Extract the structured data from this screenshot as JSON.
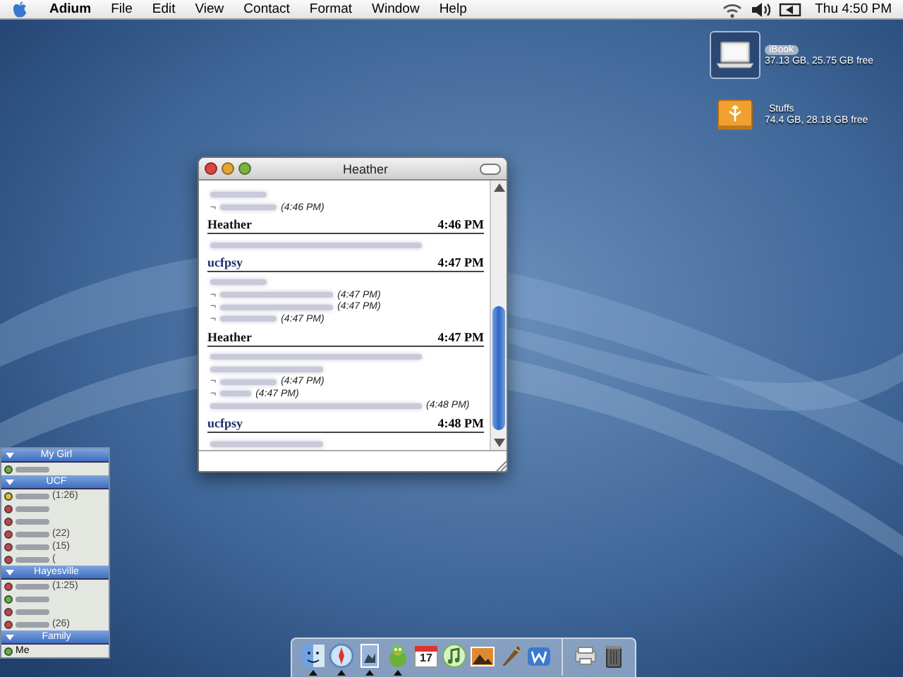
{
  "menubar": {
    "app": "Adium",
    "menus": [
      "File",
      "Edit",
      "View",
      "Contact",
      "Format",
      "Window",
      "Help"
    ],
    "clock": "Thu 4:50 PM"
  },
  "desktop_icons": [
    {
      "kind": "laptop",
      "label": "iBook",
      "detail": "37.13 GB, 25.75 GB free",
      "selected": true
    },
    {
      "kind": "drive",
      "label": "Stuffs",
      "detail": "74.4 GB, 28.18 GB free",
      "selected": false
    }
  ],
  "chat_window": {
    "title": "Heather",
    "messages": [
      {
        "lines": [
          {
            "kind": "short"
          },
          {
            "marker": "¬",
            "kind": "short",
            "time": "(4:46 PM)"
          }
        ]
      },
      {
        "sender": "Heather",
        "kind": "remote",
        "time": "4:46 PM",
        "lines": [
          {
            "kind": "long"
          }
        ]
      },
      {
        "sender": "ucfpsy",
        "kind": "local",
        "time": "4:47 PM",
        "lines": [
          {
            "kind": "short"
          },
          {
            "marker": "¬",
            "kind": "medium",
            "time": "(4:47 PM)"
          },
          {
            "marker": "¬",
            "kind": "medium",
            "time": "(4:47 PM)"
          },
          {
            "marker": "¬",
            "kind": "short",
            "time": "(4:47 PM)"
          }
        ]
      },
      {
        "sender": "Heather",
        "kind": "remote",
        "time": "4:47 PM",
        "lines": [
          {
            "kind": "long"
          },
          {
            "kind": "medium"
          },
          {
            "marker": "¬",
            "kind": "short",
            "time": "(4:47 PM)"
          },
          {
            "marker": "¬",
            "kind": "tiny",
            "time": "(4:47 PM)"
          },
          {
            "kind": "long",
            "time": "(4:48 PM)"
          }
        ]
      },
      {
        "sender": "ucfpsy",
        "kind": "local",
        "time": "4:48 PM",
        "lines": [
          {
            "kind": "medium"
          }
        ]
      }
    ]
  },
  "buddy_list": [
    {
      "name": "My Girl",
      "expanded": true,
      "buddies": [
        {
          "color": "#5fb83a"
        }
      ]
    },
    {
      "name": "UCF",
      "expanded": true,
      "buddies": [
        {
          "color": "#d8c234",
          "idle": "(1:26)"
        },
        {
          "color": "#c8424a"
        },
        {
          "color": "#c8424a"
        },
        {
          "color": "#c8424a",
          "idle": "(22)"
        },
        {
          "color": "#c8424a",
          "idle": "(15)"
        },
        {
          "color": "#c8424a",
          "idle": "("
        }
      ]
    },
    {
      "name": "Hayesville",
      "expanded": true,
      "buddies": [
        {
          "color": "#c8424a",
          "idle": "(1:25)"
        },
        {
          "color": "#5fb83a"
        },
        {
          "color": "#c8424a"
        },
        {
          "color": "#c8424a",
          "idle": "(26)"
        }
      ]
    },
    {
      "name": "Family",
      "expanded": true,
      "buddies": [
        {
          "color": "#5fb83a",
          "label": "Me"
        }
      ]
    }
  ],
  "dock": [
    {
      "kind": "finder",
      "running": true
    },
    {
      "kind": "compass",
      "running": true
    },
    {
      "kind": "stamp",
      "running": true
    },
    {
      "kind": "duck",
      "running": true
    },
    {
      "kind": "calendar",
      "running": false,
      "text": "17"
    },
    {
      "kind": "note",
      "running": false
    },
    {
      "kind": "photo",
      "running": false
    },
    {
      "kind": "quill",
      "running": false
    },
    {
      "kind": "word",
      "running": false
    },
    {
      "kind": "separator"
    },
    {
      "kind": "printer",
      "running": false
    },
    {
      "kind": "trash",
      "running": false
    }
  ]
}
